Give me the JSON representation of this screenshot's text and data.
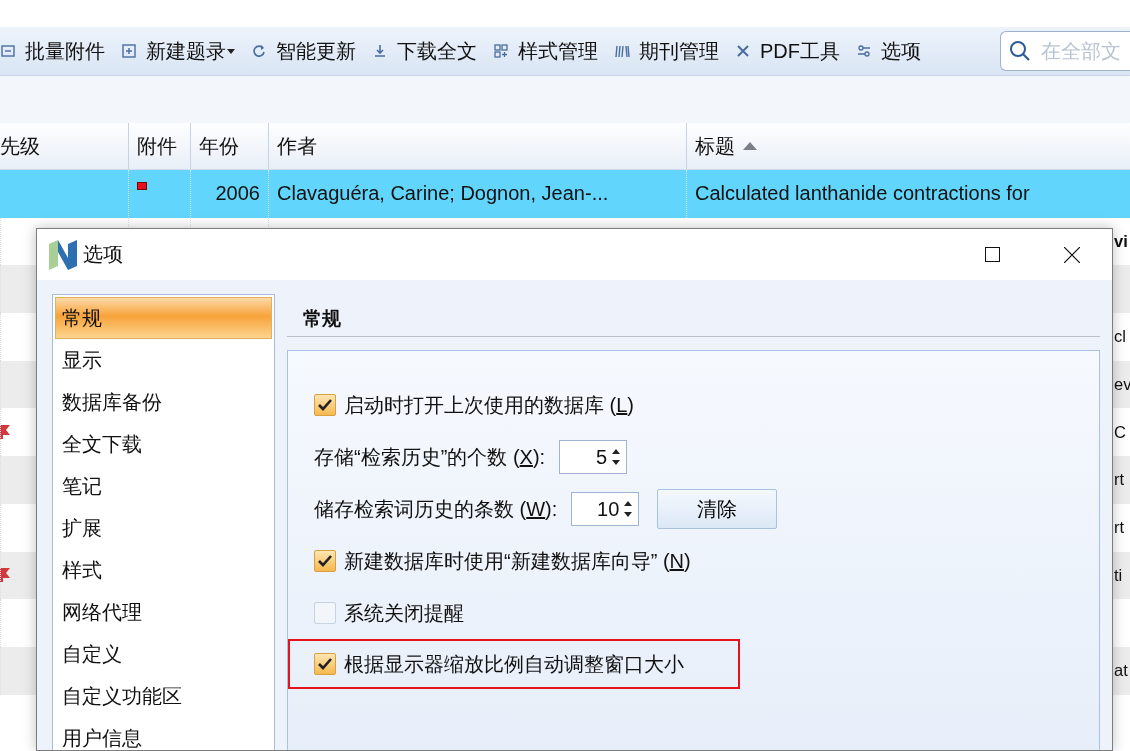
{
  "toolbar": {
    "items": [
      {
        "kind": "attach",
        "label": "批量附件",
        "dropdown": false
      },
      {
        "kind": "new",
        "label": "新建题录",
        "dropdown": true
      },
      {
        "kind": "update",
        "label": "智能更新",
        "dropdown": false
      },
      {
        "kind": "download",
        "label": "下载全文",
        "dropdown": false
      },
      {
        "kind": "style",
        "label": "样式管理",
        "dropdown": false
      },
      {
        "kind": "journal",
        "label": "期刊管理",
        "dropdown": false
      },
      {
        "kind": "pdf",
        "label": "PDF工具",
        "dropdown": false
      },
      {
        "kind": "options",
        "label": "选项",
        "dropdown": false
      }
    ],
    "search": {
      "placeholder": "在全部文"
    }
  },
  "table": {
    "columns": [
      {
        "label": "先级",
        "sorted": false
      },
      {
        "label": "附件",
        "sorted": false
      },
      {
        "label": "年份",
        "sorted": false
      },
      {
        "label": "作者",
        "sorted": false
      },
      {
        "label": "标题",
        "sorted": true
      }
    ],
    "rows": [
      {
        "selected": true,
        "flag": false,
        "attachment": true,
        "year": "2006",
        "author": "Clavaguéra, Carine; Dognon, Jean-...",
        "title": "Calculated lanthanide contractions for",
        "bold": false
      },
      {
        "selected": false,
        "flag": false,
        "title": "vi",
        "bold": true
      },
      {
        "selected": false,
        "flag": false
      },
      {
        "selected": false,
        "flag": false,
        "title": "cl",
        "bold": false
      },
      {
        "selected": false,
        "flag": false,
        "title": "ev",
        "bold": false
      },
      {
        "selected": false,
        "flag": true,
        "title": "C",
        "bold": false
      },
      {
        "selected": false,
        "flag": false,
        "title": "rt",
        "bold": false
      },
      {
        "selected": false,
        "flag": false,
        "title": "rt",
        "bold": false
      },
      {
        "selected": false,
        "flag": true,
        "title": "ti",
        "bold": false
      },
      {
        "selected": false,
        "flag": false
      },
      {
        "selected": false,
        "flag": false,
        "title": "at",
        "bold": false
      }
    ]
  },
  "dialog": {
    "title": "选项",
    "sidebar": {
      "items": [
        {
          "label": "常规",
          "selected": true
        },
        {
          "label": "显示",
          "selected": false
        },
        {
          "label": "数据库备份",
          "selected": false
        },
        {
          "label": "全文下载",
          "selected": false
        },
        {
          "label": "笔记",
          "selected": false
        },
        {
          "label": "扩展",
          "selected": false
        },
        {
          "label": "样式",
          "selected": false
        },
        {
          "label": "网络代理",
          "selected": false
        },
        {
          "label": "自定义",
          "selected": false
        },
        {
          "label": "自定义功能区",
          "selected": false
        },
        {
          "label": "用户信息",
          "selected": false
        }
      ]
    },
    "heading": "常规",
    "options": [
      {
        "kind": "checkbox",
        "before": "启动时打开上次使用的数据库 (",
        "mnemonic": "L",
        "after": ")",
        "checked": true,
        "highlighted": false
      },
      {
        "kind": "spinner",
        "before": "存储“检索历史”的个数 (",
        "mnemonic": "X",
        "after": "):",
        "value": "5"
      },
      {
        "kind": "spinner",
        "before": "储存检索词历史的条数 (",
        "mnemonic": "W",
        "after": "):",
        "value": "10",
        "button": "清除"
      },
      {
        "kind": "checkbox",
        "before": "新建数据库时使用“新建数据库向导” (",
        "mnemonic": "N",
        "after": ")",
        "checked": true,
        "highlighted": false
      },
      {
        "kind": "checkbox",
        "before": "系统关闭提醒",
        "checked": false,
        "highlighted": false
      },
      {
        "kind": "checkbox",
        "before": "根据显示器缩放比例自动调整窗口大小",
        "checked": true,
        "highlighted": true
      }
    ]
  }
}
